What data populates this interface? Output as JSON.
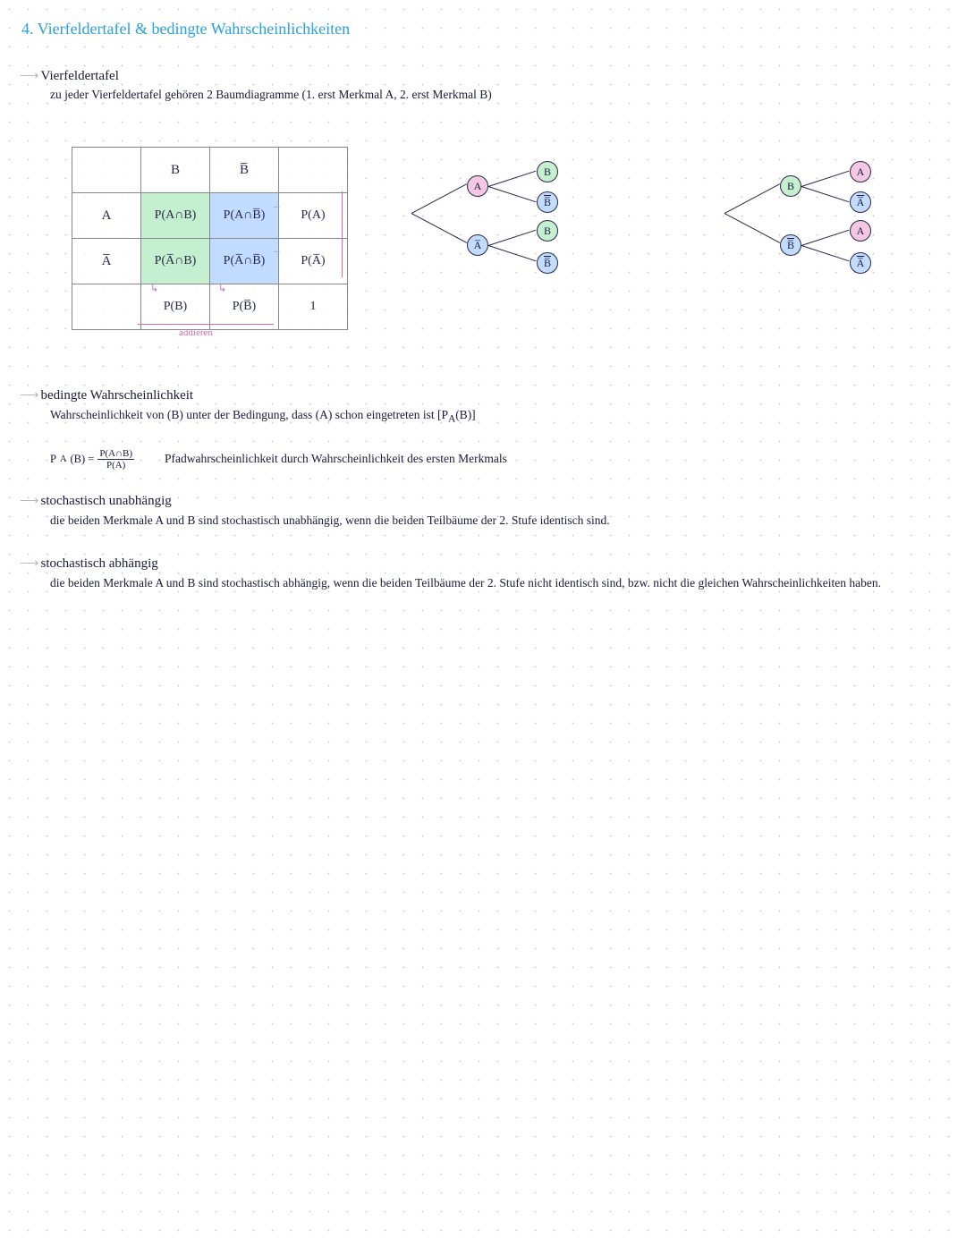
{
  "title": "4. Vierfeldertafel & bedingte Wahrscheinlichkeiten",
  "arrow": "⟶",
  "sec1": {
    "heading": "Vierfeldertafel",
    "line1": "zu jeder Vierfeldertafel gehören 2 Baumdiagramme  (1. erst Merkmal A, 2. erst Merkmal B)"
  },
  "table": {
    "h_B": "B",
    "h_notB": "B̅",
    "r_A": "A",
    "r_notA": "A̅",
    "c_AB": "P(A∩B)",
    "c_AnotB": "P(A∩B̅)",
    "c_PA": "P(A)",
    "c_notAB": "P(A̅∩B)",
    "c_notAnotB": "P(A̅∩B̅)",
    "c_PnotA": "P(A̅)",
    "c_PB": "P(B)",
    "c_PnotB": "P(B̅)",
    "c_one": "1",
    "ann_add": "addieren"
  },
  "tree1": {
    "root_top": "A",
    "root_bot": "A̅",
    "leaf_tt": "B",
    "leaf_tb": "B̅",
    "leaf_bt": "B",
    "leaf_bb": "B̅"
  },
  "tree2": {
    "root_top": "B",
    "root_bot": "B̅",
    "leaf_tt": "A",
    "leaf_tb": "A̅",
    "leaf_bt": "A",
    "leaf_bb": "A̅"
  },
  "sec2": {
    "heading": "bedingte Wahrscheinlichkeit",
    "line1": "Wahrscheinlichkeit von (B) unter der Bedingung, dass (A) schon eingetreten ist   [P",
    "line1_sub": "A",
    "line1_tail": "(B)]"
  },
  "formula": {
    "lhs_pre": "P",
    "lhs_sub": "A",
    "lhs_post": "(B) =",
    "num": "P(A∩B)",
    "den": "P(A)",
    "note": "Pfadwahrscheinlichkeit durch Wahrscheinlichkeit des ersten Merkmals"
  },
  "sec3": {
    "heading": "stochastisch unabhängig",
    "body": "die beiden Merkmale  A und B sind  stochastisch unabhängig, wenn die beiden Teilbäume der 2. Stufe identisch sind."
  },
  "sec4": {
    "heading": "stochastisch  abhängig",
    "body": "die beiden Merkmale  A und B sind  stochastisch abhängig, wenn die beiden Teilbäume der  2. Stufe  nicht  identisch  sind, bzw.  nicht  die gleichen  Wahrscheinlichkeiten  haben."
  }
}
